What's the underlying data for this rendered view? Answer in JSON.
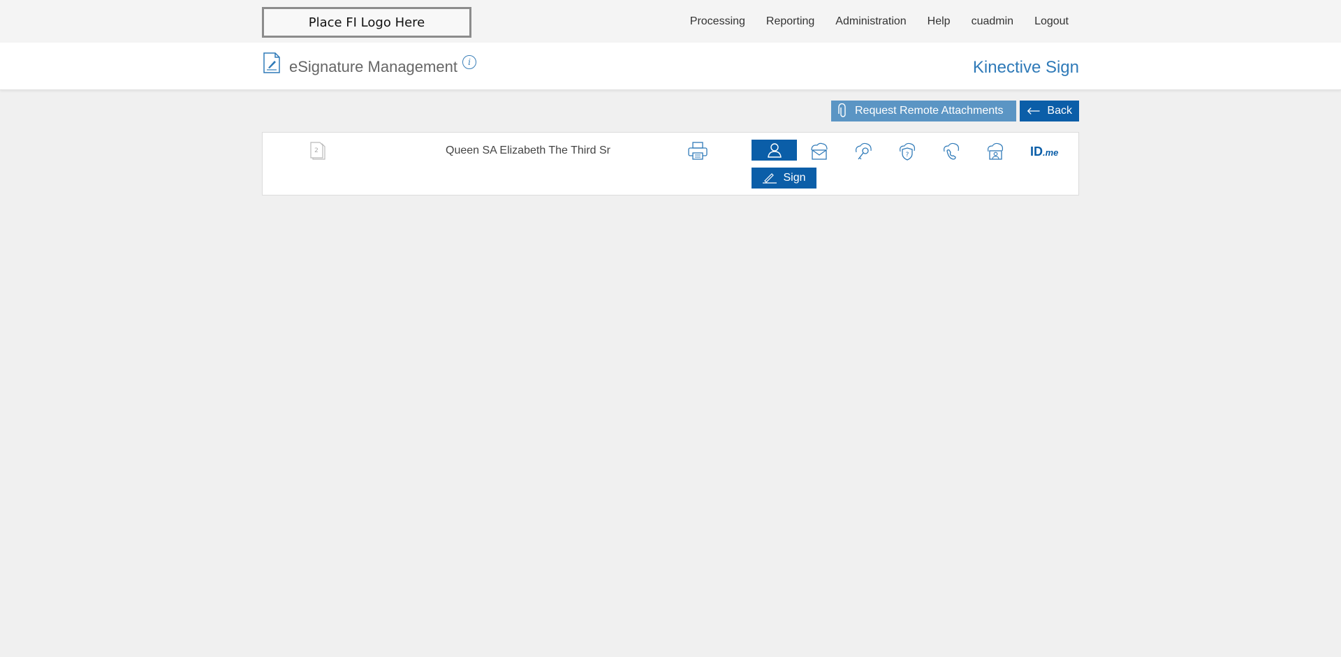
{
  "topbar": {
    "logo_text": "Place FI Logo Here",
    "nav": [
      "Processing",
      "Reporting",
      "Administration",
      "Help",
      "cuadmin",
      "Logout"
    ]
  },
  "header": {
    "title": "eSignature Management",
    "info_glyph": "i",
    "brand": "Kinective Sign"
  },
  "actions": {
    "attach_label": "Request Remote Attachments",
    "back_label": "Back"
  },
  "signer": {
    "doc_count": "2",
    "name": "Queen SA Elizabeth The Third Sr",
    "sign_label": "Sign",
    "auth_methods": [
      "in-person-icon",
      "email-icon",
      "kba-icon",
      "security-question-icon",
      "phone-icon",
      "id-verification-icon",
      "idme-logo"
    ],
    "idme_text": "ID",
    "idme_suffix": ".me"
  },
  "colors": {
    "primary": "#0b5ea8",
    "secondary": "#5b95c4",
    "brand": "#2f7ab8",
    "background": "#f0f0f0"
  }
}
